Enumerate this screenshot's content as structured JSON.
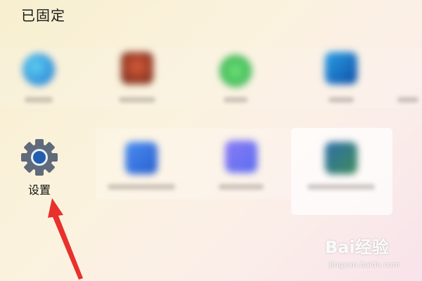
{
  "section_title": "已固定",
  "pinned_apps": [
    {
      "label": "设置",
      "icon": "gear-icon"
    }
  ],
  "watermark": {
    "brand": "Bai经验",
    "url": "jingyan.baidu.com"
  },
  "colors": {
    "gear": "#5f6a7a",
    "gear_center": "#1f5fae",
    "arrow": "#e8312c"
  }
}
